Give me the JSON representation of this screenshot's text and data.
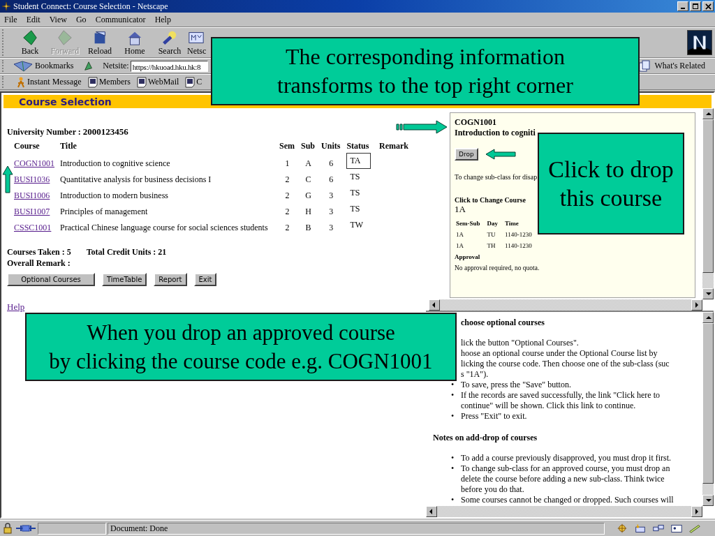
{
  "window": {
    "title": "Student Connect: Course Selection - Netscape"
  },
  "menu": [
    "File",
    "Edit",
    "View",
    "Go",
    "Communicator",
    "Help"
  ],
  "nav_buttons": [
    {
      "label": "Back",
      "kind": "back",
      "disabled": false
    },
    {
      "label": "Forward",
      "kind": "forward",
      "disabled": true
    },
    {
      "label": "Reload",
      "kind": "reload",
      "disabled": false
    },
    {
      "label": "Home",
      "kind": "home",
      "disabled": false
    },
    {
      "label": "Search",
      "kind": "search",
      "disabled": false
    },
    {
      "label": "Netsc",
      "kind": "my",
      "disabled": false
    }
  ],
  "location": {
    "bookmarks": "Bookmarks",
    "label": "Netsite:",
    "url": "https://hkuoad.hku.hk:8",
    "related": "What's Related"
  },
  "personal": [
    {
      "label": "Instant Message",
      "kind": "person"
    },
    {
      "label": "Members",
      "kind": "page"
    },
    {
      "label": "WebMail",
      "kind": "page"
    },
    {
      "label": "C",
      "kind": "page"
    }
  ],
  "page": {
    "header": "Course Selection",
    "number_label": "University Number :",
    "number": "2000123456",
    "columns": [
      "Course",
      "Title",
      "Sem",
      "Sub",
      "Units",
      "Status",
      "Remark"
    ],
    "rows": [
      {
        "course": "COGN1001",
        "title": "Introduction to cognitive science",
        "sem": "1",
        "sub": "A",
        "units": "6",
        "status": "TA",
        "selected": true
      },
      {
        "course": "BUSI1036",
        "title": "Quantitative analysis for business decisions I",
        "sem": "2",
        "sub": "C",
        "units": "6",
        "status": "TS",
        "selected": false
      },
      {
        "course": "BUSI1006",
        "title": "Introduction to modern business",
        "sem": "2",
        "sub": "G",
        "units": "3",
        "status": "TS",
        "selected": false
      },
      {
        "course": "BUSI1007",
        "title": "Principles of management",
        "sem": "2",
        "sub": "H",
        "units": "3",
        "status": "TS",
        "selected": false
      },
      {
        "course": "CSSC1001",
        "title": "Practical Chinese language course for social sciences students",
        "sem": "2",
        "sub": "B",
        "units": "3",
        "status": "TW",
        "selected": false
      }
    ],
    "courses_taken": "Courses Taken : 5",
    "total_units": "Total Credit Units : 21",
    "overall_remark": "Overall Remark :",
    "buttons": [
      "Optional Courses",
      "TimeTable",
      "Report",
      "Exit"
    ],
    "help": "Help"
  },
  "detail": {
    "code": "COGN1001",
    "title": "Introduction to cogniti",
    "drop": "Drop",
    "note": "To change sub-class for disap",
    "change_label": "Click to Change Course",
    "subclass": "1A",
    "columns": [
      "Sem-Sub",
      "Day",
      "Time"
    ],
    "rows": [
      [
        "1A",
        "TU",
        "1140-1230"
      ],
      [
        "1A",
        "TH",
        "1140-1230"
      ]
    ],
    "approval_label": "Approval",
    "approval": "No approval required, no quota."
  },
  "help_frame": {
    "heading": "choose optional courses",
    "steps": [
      {
        "lines": [
          "lick the button \"Optional Courses\"."
        ]
      },
      {
        "lines": [
          "hoose an optional course under the Optional Course list by",
          "licking the course code. Then choose one of the sub-class (suc",
          "s \"1A\")."
        ]
      },
      {
        "lines": [
          "To save, press the \"Save\" button."
        ],
        "marker": "•"
      },
      {
        "lines": [
          "If the records are saved successfully, the link \"Click here to",
          "continue\" will be shown. Click this link to continue."
        ],
        "marker": "•"
      },
      {
        "lines": [
          "Press \"Exit\" to exit."
        ],
        "marker": "•"
      }
    ],
    "notes_heading": "Notes on add-drop of courses",
    "notes": [
      {
        "lines": [
          "To add a course previously disapproved, you must drop it first."
        ],
        "marker": "•"
      },
      {
        "lines": [
          "To change sub-class for an approved course, you must drop an",
          "delete the course before adding a new sub-class. Think twice",
          "before you do that."
        ],
        "marker": "•"
      },
      {
        "lines": [
          "Some courses cannot be changed or dropped. Such courses will"
        ],
        "marker": "•"
      }
    ]
  },
  "status_bar": {
    "text": "Document: Done"
  },
  "callouts": [
    {
      "lines": [
        "The corresponding information",
        "transforms to the top right corner"
      ]
    },
    {
      "lines": [
        "Click to drop",
        "this course"
      ]
    },
    {
      "lines": [
        "When you drop an approved course",
        "by clicking the course code e.g. COGN1001"
      ]
    }
  ]
}
